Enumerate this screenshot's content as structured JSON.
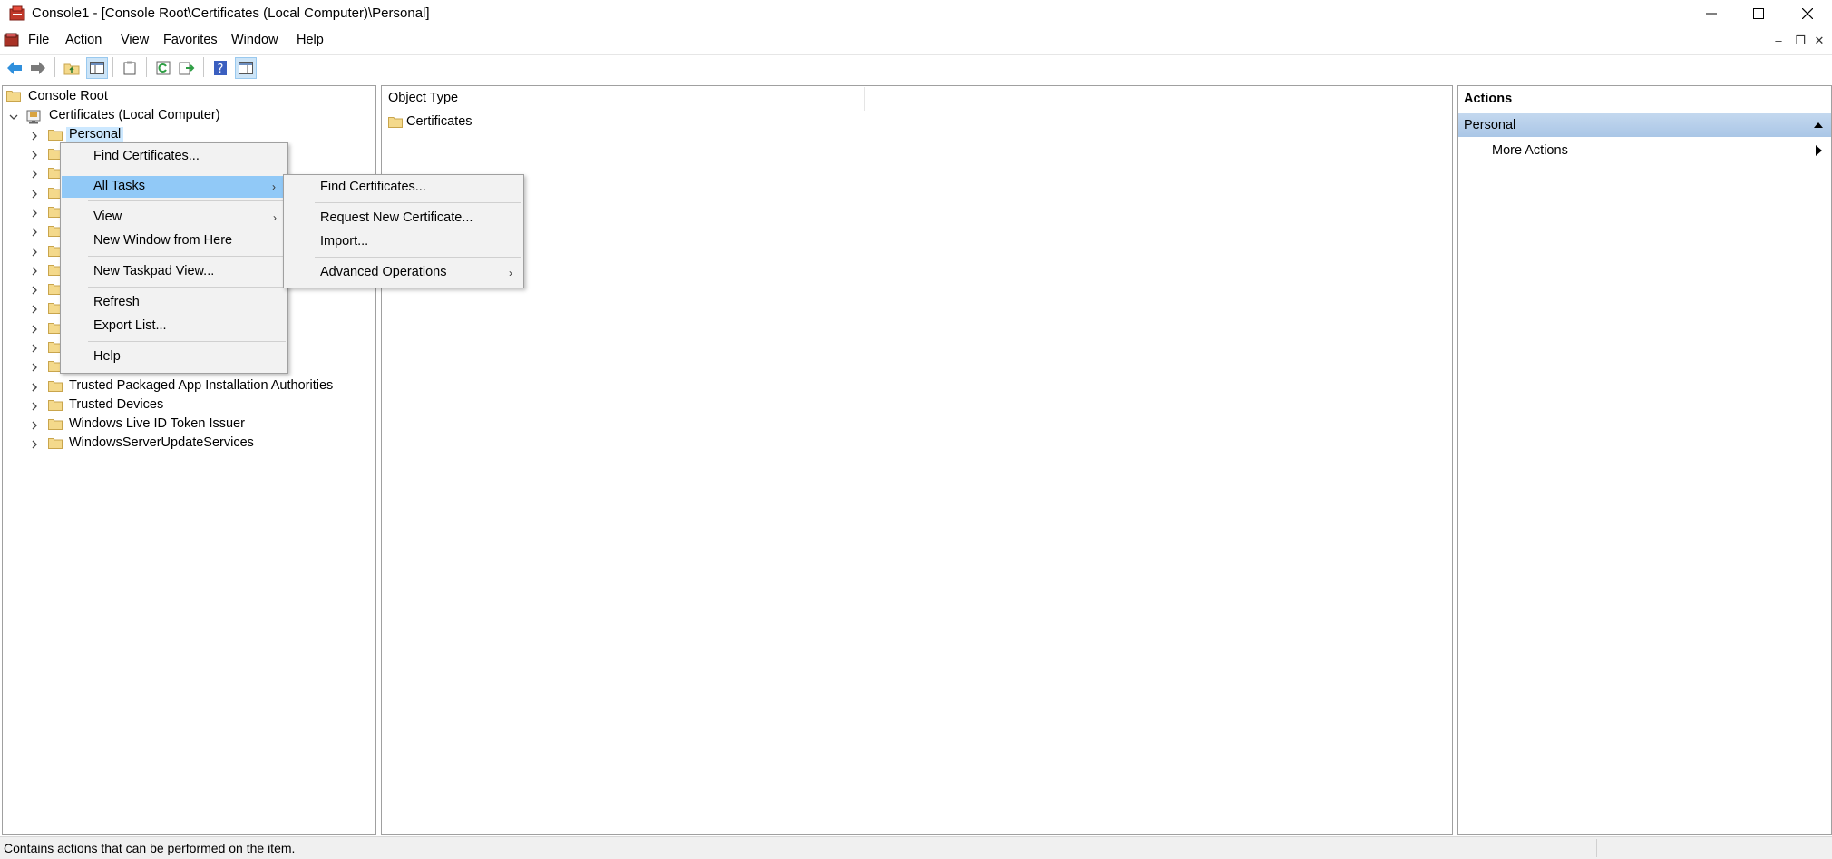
{
  "window": {
    "title": "Console1 - [Console Root\\Certificates (Local Computer)\\Personal]",
    "min_icon": "minimize-icon",
    "max_icon": "maximize-icon",
    "close_icon": "close-icon"
  },
  "menubar": {
    "items": [
      "File",
      "Action",
      "View",
      "Favorites",
      "Window",
      "Help"
    ]
  },
  "toolbar": {
    "buttons": [
      "back-icon",
      "forward-icon",
      "up-folder-icon",
      "show-hide-tree-icon",
      "properties-icon",
      "refresh-icon",
      "export-list-icon",
      "help-icon",
      "show-hide-action-pane-icon"
    ]
  },
  "tree": {
    "root": "Console Root",
    "certificates": "Certificates (Local Computer)",
    "personal": "Personal",
    "items_below": [
      "Trusted Packaged App Installation Authorities",
      "Trusted Devices",
      "Windows Live ID Token Issuer",
      "WindowsServerUpdateServices"
    ]
  },
  "results": {
    "column": "Object Type",
    "rows": [
      "Certificates"
    ]
  },
  "actions": {
    "title": "Actions",
    "section": "Personal",
    "more": "More Actions"
  },
  "context_menu": {
    "items": [
      "Find Certificates...",
      "All Tasks",
      "View",
      "New Window from Here",
      "New Taskpad View...",
      "Refresh",
      "Export List...",
      "Help"
    ]
  },
  "submenu": {
    "items": [
      "Find Certificates...",
      "Request New Certificate...",
      "Import...",
      "Advanced Operations"
    ]
  },
  "statusbar": {
    "text": "Contains actions that can be performed on the item."
  },
  "colors": {
    "selection": "#cce8ff",
    "menu_highlight": "#91c9f7",
    "actions_header": "#b4cde9",
    "folder": "#f4d98b"
  }
}
